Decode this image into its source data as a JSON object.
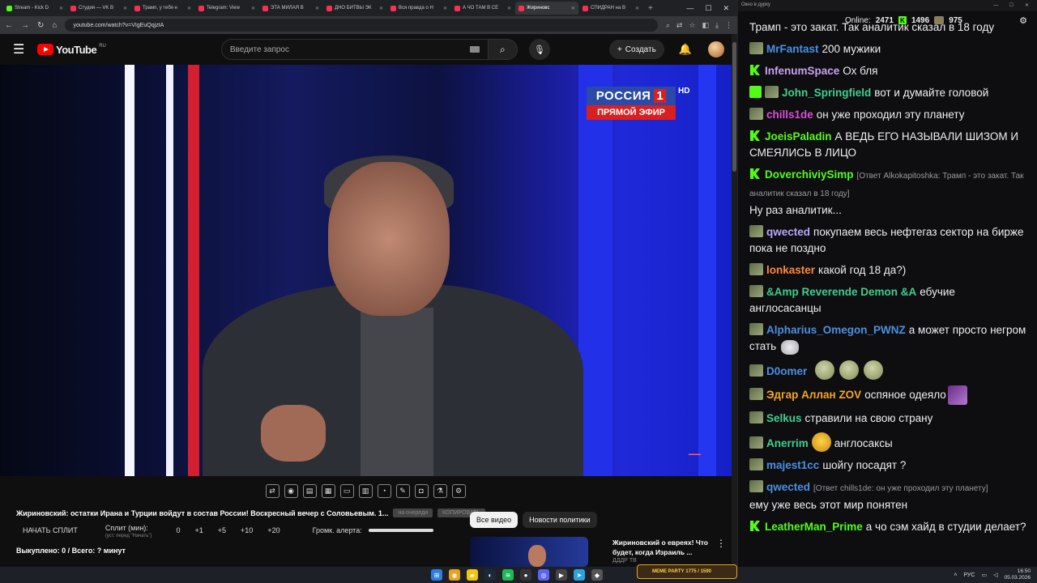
{
  "browser": {
    "tabs": [
      {
        "label": "Stream - Kick D",
        "color": "#53fc18"
      },
      {
        "label": "Студия — VK В",
        "color": "#ff2d55"
      },
      {
        "label": "Трамп, у тебя н",
        "color": "#ff2d55"
      },
      {
        "label": "Telegram: View",
        "color": "#ff2d55"
      },
      {
        "label": "ЭТА МИЛАЯ В",
        "color": "#ff2d55"
      },
      {
        "label": "ДНО БИТВЫ ЭК",
        "color": "#ff2d55"
      },
      {
        "label": "Вся правда о Н",
        "color": "#ff2d55"
      },
      {
        "label": "А ЧО ТАМ В СЕ",
        "color": "#ff2d55"
      },
      {
        "label": "Жириновс",
        "color": "#ff2d55"
      },
      {
        "label": "СПИДРАН на В",
        "color": "#ff2d55"
      }
    ],
    "url": "youtube.com/watch?v=VIgEuQqjztA"
  },
  "youtube": {
    "logo": "YouTube",
    "region": "RU",
    "search_placeholder": "Введите запрос",
    "create_label": "Создать"
  },
  "video": {
    "channel_name": "РОССИЯ",
    "channel_num": "1",
    "channel_hd": "HD",
    "live_label": "ПРЯМОЙ ЭФИР",
    "title": "Жириновский: остатки Ирана и Турции войдут в состав России! Воскресный вечер с Соловьевым. 1...",
    "btn_to_queue": "на очереди",
    "btn_copy": "КОПИРОВАТЬ"
  },
  "split": {
    "start_label": "НАЧАТЬ СПЛИТ",
    "min_label": "Сплит (мин):",
    "min_sub": "(уст. перед \"Начать\")",
    "values": [
      "0",
      "+1",
      "+5",
      "+10",
      "+20"
    ],
    "alert_label": "Громк. алерта:",
    "bought": "Выкуплено: 0 / Всего: ? минут"
  },
  "chips": [
    "Все видео",
    "Новости политики"
  ],
  "recommend": {
    "title": "Жириновский о евреях! Что будет, когда Израиль ...",
    "sub": "ДДДР ТВ"
  },
  "chat_window": {
    "title": "Окно в дурку",
    "online_label": "Online:",
    "online": "2471",
    "kick_count": "1496",
    "other_count": "975",
    "partial": "Трамп - это закат. Так аналитик сказал в 18 году",
    "messages": [
      {
        "user": "MrFantast",
        "color": "#4a90e2",
        "badge": "sub",
        "text": "200 мужики"
      },
      {
        "user": "InfenumSpace",
        "color": "#c8a2f0",
        "badge": "kick",
        "text": "Ох бля"
      },
      {
        "user": "John_Springfield",
        "color": "#3ecf8e",
        "badge": "edit-sub",
        "text": "вот и думайте головой"
      },
      {
        "user": "chills1de",
        "color": "#d94fd9",
        "badge": "sub",
        "text": "он уже проходил эту планету"
      },
      {
        "user": "JoeisPaladin",
        "color": "#53fc18",
        "badge": "kick",
        "text": "А ВЕДЬ ЕГО НАЗЫВАЛИ ШИЗОМ И СМЕЯЛИСЬ В ЛИЦО"
      },
      {
        "user": "DoverchiviySimp",
        "color": "#53fc18",
        "badge": "kick",
        "reply": "[Ответ Alkokapitoshka: Трамп - это закат. Так аналитик сказал в 18 году]",
        "text": "Ну раз аналитик..."
      },
      {
        "user": "qwected",
        "color": "#b8a6ff",
        "badge": "sub",
        "text": "покупаем весь нефтегаз сектор на бирже пока не поздно"
      },
      {
        "user": "lonkaster",
        "color": "#ff8a3d",
        "badge": "sub",
        "text": "какой год 18 да?)"
      },
      {
        "user": "&Amp Reverende Demon &A",
        "color": "#3ecf8e",
        "badge": "sub",
        "text": "ебучие англосасанцы"
      },
      {
        "user": "Alpharius_Omegon_PWNZ",
        "color": "#4a90e2",
        "badge": "sub",
        "text": "а может просто негром стать"
      },
      {
        "user": "D0omer",
        "color": "#4a90e2",
        "badge": "sub",
        "text": ""
      },
      {
        "user": "Эдгар Аллан ZOV",
        "color": "#f5a623",
        "badge": "sub",
        "text": "оспяное одеяло"
      },
      {
        "user": "Selkus",
        "color": "#3ecf8e",
        "badge": "sub",
        "text": "стравили на свою страну"
      },
      {
        "user": "Anerrim",
        "color": "#3ecf8e",
        "badge": "sub",
        "text": "англосаксы"
      },
      {
        "user": "majest1cc",
        "color": "#4a90e2",
        "badge": "sub",
        "text": "шойгу посадят ?"
      },
      {
        "user": "qwected",
        "color": "#4a90e2",
        "badge": "sub",
        "reply": "[Ответ chills1de: он уже проходил эту планету]",
        "text": "ему уже весь этот мир понятен"
      },
      {
        "user": "LeatherMan_Prime",
        "color": "#53fc18",
        "badge": "kick",
        "text": "а чо сэм хайд в студии делает?"
      }
    ]
  },
  "taskbar": {
    "lang": "РУС",
    "time": "16:50",
    "date": "05.03.2026",
    "meme_label": "MEME PARTY",
    "meme_values": "1775 / 1590"
  },
  "colors": {
    "accent_red": "#ff0000",
    "kick_green": "#53fc18",
    "russia_blue": "#2b4aa8"
  }
}
